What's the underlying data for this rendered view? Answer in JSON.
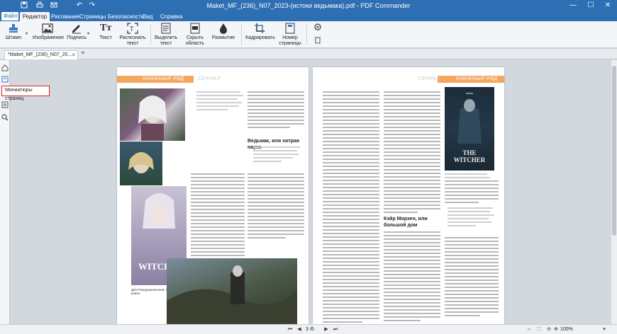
{
  "window": {
    "title": "Maket_MF_(236)_N07_2023-(истоки ведьмака).pdf - PDF Commander"
  },
  "menu": {
    "file": "Файл",
    "tabs": [
      "Редактор",
      "Рисование",
      "Страницы",
      "Безопасность",
      "Вид",
      "Справка"
    ],
    "active_tab": "Редактор"
  },
  "ribbon": {
    "stamp": "Штамп",
    "image": "Изображение",
    "signature": "Подпись",
    "text": "Текст",
    "recognize": "Распознать текст",
    "select_text": "Выделить текст",
    "hide_area": "Скрыть область",
    "blur": "Размытие",
    "crop": "Кадрировать",
    "page_number": "Номер страницы"
  },
  "document": {
    "tab_label": "*Maket_MF_(236)_N07_20...",
    "add_tab": "+"
  },
  "tooltip": {
    "text": "Миниатюры страниц"
  },
  "pages": {
    "left": {
      "header_section": "КНИЖНЫЙ РЯД",
      "header_sub": "СЕРИАЛ",
      "subheading": "Ведьмак, или хитрая наука",
      "caption": "Дитя Предназначения: когда подавно, ровно"
    },
    "right": {
      "header_section": "КНИЖНЫЙ РЯД",
      "header_sub": "СЕРИАЛ",
      "subheading": "Кэйр Морхен, или большой дом",
      "book_title": "THE WITCHER"
    }
  },
  "status": {
    "page_current": "3",
    "page_total": "/6",
    "zoom": "100%"
  },
  "colors": {
    "accent": "#2e6fb4",
    "header_orange": "#f4a65d",
    "highlight": "#e02020"
  }
}
